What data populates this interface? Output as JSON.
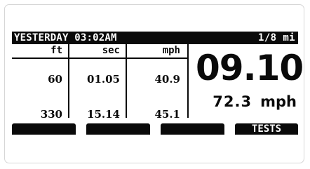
{
  "header": {
    "title": "YESTERDAY 03:02AM",
    "distance": "1/8 mi"
  },
  "table": {
    "columns": [
      "ft",
      "sec",
      "mph"
    ],
    "rows": [
      [
        "60",
        "01.05",
        "40.9"
      ],
      [
        "330",
        "15.14",
        "45.1"
      ]
    ]
  },
  "result": {
    "elapsed_time": "09.10",
    "trap_speed": "72.3",
    "trap_speed_unit": "mph"
  },
  "softkeys": [
    "",
    "",
    "",
    "TESTS"
  ],
  "colors": {
    "lcd_ink": "#0a0a0a",
    "lcd_background": "#ffffff",
    "card_border": "#d6d6d6"
  }
}
